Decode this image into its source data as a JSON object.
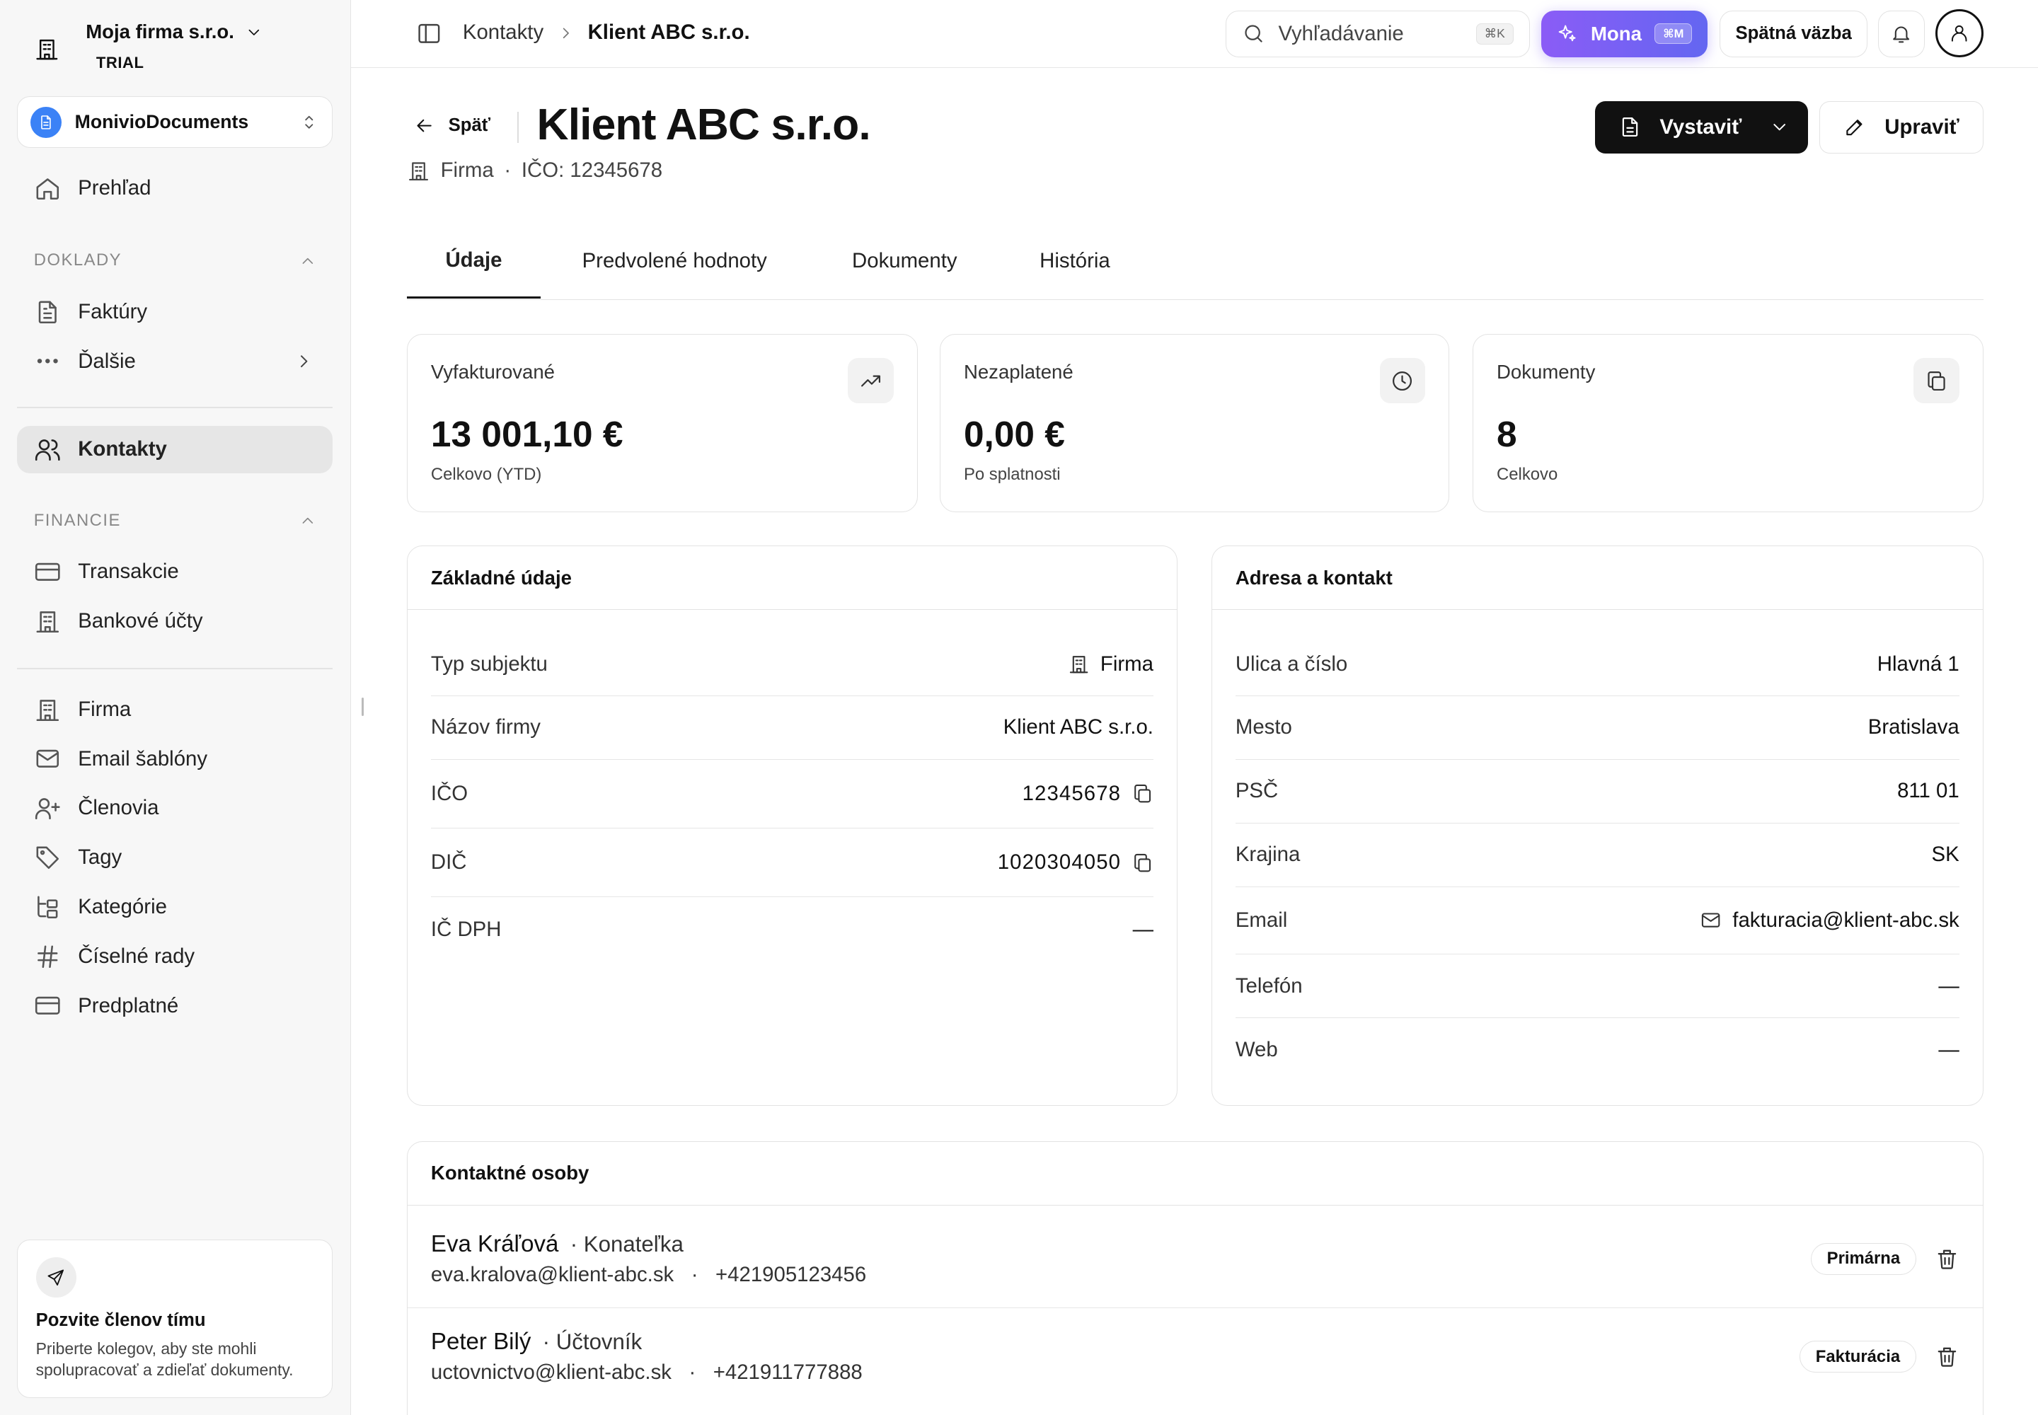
{
  "sidebar": {
    "org_name": "Moja firma s.r.o.",
    "org_plan": "TRIAL",
    "workspace": "MonivioDocuments",
    "overview": "Prehľad",
    "section_docs": "DOKLADY",
    "invoices": "Faktúry",
    "more": "Ďalšie",
    "contacts": "Kontakty",
    "section_finance": "FINANCIE",
    "transactions": "Transakcie",
    "bank_accounts": "Bankové účty",
    "company": "Firma",
    "email_templates": "Email šablóny",
    "members": "Členovia",
    "tags": "Tagy",
    "categories": "Kategórie",
    "number_series": "Číselné rady",
    "subscription": "Predplatné",
    "invite_title": "Pozvite členov tímu",
    "invite_text": "Priberte kolegov, aby ste mohli spolupracovať a zdieľať dokumenty."
  },
  "topbar": {
    "breadcrumb_parent": "Kontakty",
    "breadcrumb_current": "Klient ABC s.r.o.",
    "search_placeholder": "Vyhľadávanie",
    "search_shortcut": "⌘K",
    "mona_label": "Mona",
    "mona_shortcut": "⌘M",
    "feedback_label": "Spätná väzba"
  },
  "header": {
    "back_label": "Späť",
    "title": "Klient ABC s.r.o.",
    "type": "Firma",
    "ico_line": "IČO: 12345678",
    "issue_label": "Vystaviť",
    "edit_label": "Upraviť"
  },
  "tabs": [
    "Údaje",
    "Predvolené hodnoty",
    "Dokumenty",
    "História"
  ],
  "stats": [
    {
      "label": "Vyfakturované",
      "value": "13 001,10 €",
      "sub": "Celkovo (YTD)",
      "icon": "trending-up-icon"
    },
    {
      "label": "Nezaplatené",
      "value": "0,00 €",
      "sub": "Po splatnosti",
      "icon": "clock-icon"
    },
    {
      "label": "Dokumenty",
      "value": "8",
      "sub": "Celkovo",
      "icon": "copy-icon"
    }
  ],
  "basic": {
    "title": "Základné údaje",
    "rows": [
      {
        "key": "Typ subjektu",
        "value": "Firma"
      },
      {
        "key": "Názov firmy",
        "value": "Klient ABC s.r.o."
      },
      {
        "key": "IČO",
        "value": "12345678"
      },
      {
        "key": "DIČ",
        "value": "1020304050"
      },
      {
        "key": "IČ DPH",
        "value": "—"
      }
    ]
  },
  "address": {
    "title": "Adresa a kontakt",
    "rows": [
      {
        "key": "Ulica a číslo",
        "value": "Hlavná 1"
      },
      {
        "key": "Mesto",
        "value": "Bratislava"
      },
      {
        "key": "PSČ",
        "value": "811 01"
      },
      {
        "key": "Krajina",
        "value": "SK"
      },
      {
        "key": "Email",
        "value": "fakturacia@klient-abc.sk"
      },
      {
        "key": "Telefón",
        "value": "—"
      },
      {
        "key": "Web",
        "value": "—"
      }
    ]
  },
  "persons": {
    "title": "Kontaktné osoby",
    "items": [
      {
        "name": "Eva Kráľová",
        "role": "· Konateľka",
        "email": "eva.kralova@klient-abc.sk",
        "phone": "+421905123456",
        "badge": "Primárna"
      },
      {
        "name": "Peter Bilý",
        "role": "· Účtovník",
        "email": "uctovnictvo@klient-abc.sk",
        "phone": "+421911777888",
        "badge": "Fakturácia"
      }
    ],
    "dot": "·"
  },
  "colors": {
    "accent_start": "#8b5cf6",
    "accent_end": "#6366f1",
    "workspace_badge": "#3b82f6",
    "primary_button": "#111111"
  }
}
